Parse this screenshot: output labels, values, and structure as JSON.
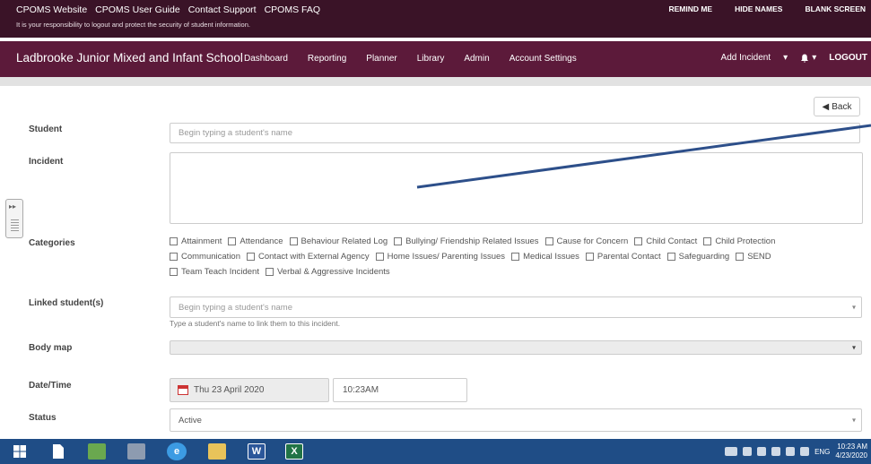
{
  "topbar": {
    "links": [
      "CPOMS Website",
      "CPOMS User Guide",
      "Contact Support",
      "CPOMS FAQ"
    ],
    "note": "It is your responsibility to logout and protect the security of student information.",
    "right": [
      "REMIND ME",
      "HIDE NAMES",
      "BLANK SCREEN"
    ]
  },
  "navbar": {
    "school": "Ladbrooke Junior Mixed and Infant School",
    "links": [
      "Dashboard",
      "Reporting",
      "Planner",
      "Library",
      "Admin",
      "Account Settings"
    ],
    "add_incident": "Add Incident",
    "add_caret": "▾",
    "bell_caret": "▾",
    "logout": "LOGOUT"
  },
  "form": {
    "back_label": "Back",
    "student": {
      "label": "Student",
      "placeholder": "Begin typing a student's name"
    },
    "incident": {
      "label": "Incident",
      "value": ""
    },
    "categories": {
      "label": "Categories",
      "rows": [
        [
          "Attainment",
          "Attendance",
          "Behaviour Related Log",
          "Bullying/ Friendship Related Issues",
          "Cause for Concern",
          "Child Contact",
          "Child Protection"
        ],
        [
          "Communication",
          "Contact with External Agency",
          "Home Issues/ Parenting Issues",
          "Medical Issues",
          "Parental Contact",
          "Safeguarding",
          "SEND"
        ],
        [
          "Team Teach Incident",
          "Verbal & Aggressive Incidents"
        ]
      ]
    },
    "linked": {
      "label": "Linked student(s)",
      "placeholder": "Begin typing a student's name",
      "help": "Type a student's name to link them to this incident."
    },
    "body_map": {
      "label": "Body map"
    },
    "datetime": {
      "label": "Date/Time",
      "date": "Thu 23 April 2020",
      "time": "10:23AM"
    },
    "status": {
      "label": "Status",
      "value": "Active"
    }
  },
  "taskbar": {
    "apps": [
      "windows-start",
      "file-explorer-doc",
      "app-green",
      "recycle",
      "internet-explorer",
      "folder",
      "word",
      "excel"
    ],
    "word_letter": "W",
    "excel_letter": "X",
    "lang": "ENG",
    "time": "10:23 AM",
    "date": "4/23/2020"
  },
  "colors": {
    "topbar": "#3a1327",
    "navbar": "#5c1a3a",
    "taskbar": "#1f4d86",
    "annotation": "#2d4f8a"
  }
}
